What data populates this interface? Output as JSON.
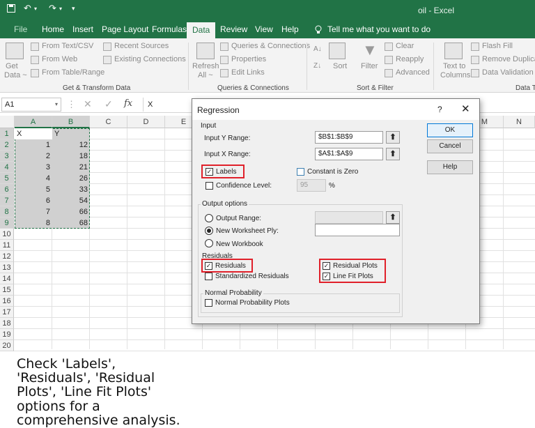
{
  "window": {
    "title": "oil  -  Excel"
  },
  "quick_access": {
    "save_icon": "save-icon",
    "undo_icon": "undo-icon",
    "redo_icon": "redo-icon",
    "customize_icon": "customize-qat-icon"
  },
  "ribbon_tabs": [
    {
      "label": "File"
    },
    {
      "label": "Home"
    },
    {
      "label": "Insert"
    },
    {
      "label": "Page Layout"
    },
    {
      "label": "Formulas"
    },
    {
      "label": "Data"
    },
    {
      "label": "Review"
    },
    {
      "label": "View"
    },
    {
      "label": "Help"
    }
  ],
  "active_tab": "Data",
  "tell_me": "Tell me what you want to do",
  "ribbon": {
    "get_data": {
      "line1": "Get",
      "line2": "Data ~"
    },
    "from_text": "From Text/CSV",
    "from_web": "From Web",
    "from_table": "From Table/Range",
    "recent_sources": "Recent Sources",
    "existing_connections": "Existing Connections",
    "group_get_transform": "Get & Transform Data",
    "refresh": {
      "line1": "Refresh",
      "line2": "All ~"
    },
    "queries_connections": "Queries & Connections",
    "properties": "Properties",
    "edit_links": "Edit Links",
    "group_queries": "Queries & Connections",
    "sort": "Sort",
    "filter": "Filter",
    "clear": "Clear",
    "reapply": "Reapply",
    "advanced": "Advanced",
    "group_sort_filter": "Sort & Filter",
    "text_to_columns": {
      "line1": "Text to",
      "line2": "Columns"
    },
    "flash_fill": "Flash Fill",
    "remove_duplicates": "Remove Duplicat",
    "data_validation": "Data Validation",
    "group_data_tools": "Data T"
  },
  "formula_bar": {
    "name_box": "A1",
    "fx": "fx",
    "value": "X"
  },
  "grid": {
    "columns": [
      "A",
      "B",
      "C",
      "D",
      "E",
      "F",
      "G",
      "H",
      "I",
      "J",
      "K",
      "L",
      "M",
      "N"
    ],
    "rows": [
      "1",
      "2",
      "3",
      "4",
      "5",
      "6",
      "7",
      "8",
      "9",
      "10",
      "11",
      "12",
      "13",
      "14",
      "15",
      "16",
      "17",
      "18",
      "19",
      "20"
    ],
    "headers": {
      "A": "X",
      "B": "Y"
    },
    "data": [
      {
        "x": "1",
        "y": "12"
      },
      {
        "x": "2",
        "y": "18"
      },
      {
        "x": "3",
        "y": "21"
      },
      {
        "x": "4",
        "y": "26"
      },
      {
        "x": "5",
        "y": "33"
      },
      {
        "x": "6",
        "y": "54"
      },
      {
        "x": "7",
        "y": "66"
      },
      {
        "x": "8",
        "y": "68"
      }
    ]
  },
  "note": "Check 'Labels', 'Residuals', 'Residual Plots', 'Line Fit Plots' options for a comprehensive analysis.",
  "dialog": {
    "title": "Regression",
    "help_char": "?",
    "close_char": "✕",
    "input_section": "Input",
    "input_y_label": "Input Y Range:",
    "input_y_value": "$B$1:$B$9",
    "input_x_label": "Input X Range:",
    "input_x_value": "$A$1:$A$9",
    "labels": {
      "label": "Labels",
      "checked": true
    },
    "constant_zero": {
      "label": "Constant is Zero",
      "checked": false
    },
    "confidence": {
      "label": "Confidence Level:",
      "value": "95",
      "unit": "%",
      "checked": false
    },
    "output_section": "Output options",
    "output_range": "Output Range:",
    "new_worksheet": "New Worksheet Ply:",
    "new_workbook": "New Workbook",
    "selected_output": "new_worksheet",
    "residuals_section": "Residuals",
    "residuals": {
      "label": "Residuals",
      "checked": true
    },
    "standardized": {
      "label": "Standardized Residuals",
      "checked": false
    },
    "residual_plots": {
      "label": "Residual Plots",
      "checked": true
    },
    "line_fit_plots": {
      "label": "Line Fit Plots",
      "checked": true
    },
    "normal_section": "Normal Probability",
    "normal_plots": {
      "label": "Normal Probability Plots",
      "checked": false
    },
    "ok": "OK",
    "cancel": "Cancel",
    "help": "Help",
    "pick_icon": "collapse-dialog-icon",
    "check_mark": "☑"
  },
  "colors": {
    "excel_green": "#217346",
    "highlight_red": "#e0202a"
  }
}
